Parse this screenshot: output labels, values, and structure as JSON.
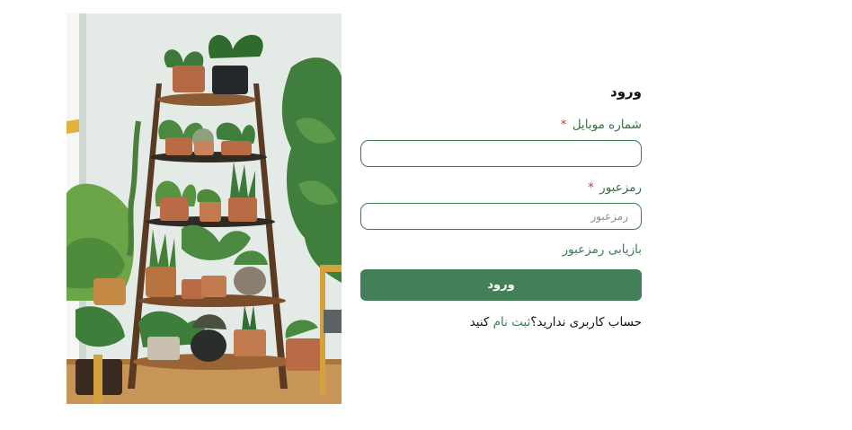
{
  "form": {
    "title": "ورود",
    "mobile_label": "شماره موبایل",
    "mobile_value": "",
    "mobile_placeholder": "",
    "password_label": "رمزعبور",
    "password_value": "",
    "password_placeholder": "رمزعبور",
    "required_mark": "*",
    "forgot_link": "بازیابی رمزعبور",
    "submit_label": "ورود",
    "signup_prompt": "حساب کاربری ندارید؟",
    "signup_link": "ثبت نام",
    "signup_suffix": " کنید"
  },
  "colors": {
    "accent": "#437f58",
    "label": "#3e6b48",
    "required": "#d83434"
  },
  "image": {
    "alt": "plants-on-wooden-ladder-shelf"
  }
}
